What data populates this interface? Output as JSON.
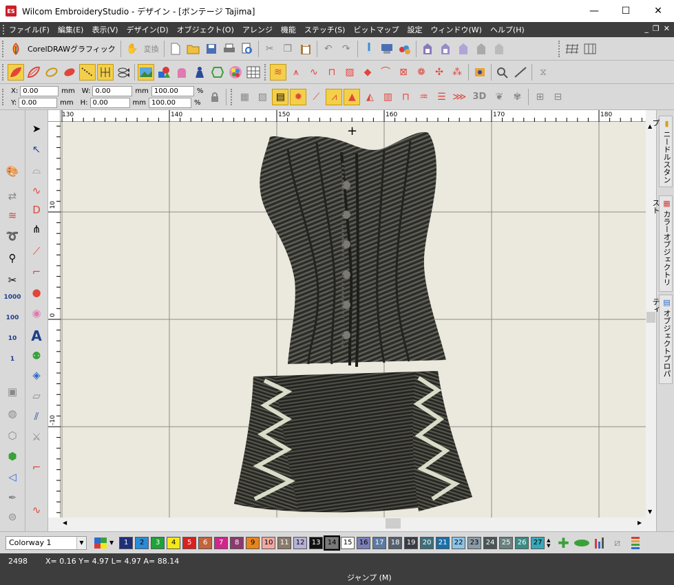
{
  "window": {
    "title": "Wilcom EmbroideryStudio - デザイン - [ボンテージ          Tajima]",
    "logo_text": "ES",
    "minimize": "—",
    "maximize": "☐",
    "close": "✕"
  },
  "menu": [
    "ファイル(F)",
    "編集(E)",
    "表示(V)",
    "デザイン(D)",
    "オブジェクト(O)",
    "アレンジ",
    "機能",
    "ステッチ(S)",
    "ビットマップ",
    "設定",
    "ウィンドウ(W)",
    "ヘルプ(H)"
  ],
  "mdi_controls": [
    "_",
    "❐",
    "✕"
  ],
  "toolbar1": {
    "coreldraw_label": "CorelDRAWグラフィック",
    "convert_label": "変換"
  },
  "coords": {
    "x_label": "X:",
    "x_value": "0.00",
    "y_label": "Y:",
    "y_value": "0.00",
    "w_label": "W:",
    "w_value": "0.00",
    "h_label": "H:",
    "h_value": "0.00",
    "scale_x": "100.00",
    "scale_y": "100.00",
    "unit_mm": "mm",
    "unit_pct": "%"
  },
  "toolbar3_text": {
    "three_d": "3D"
  },
  "ruler": {
    "top_labels": [
      "130",
      "140",
      "150",
      "160",
      "170",
      "180"
    ],
    "left_labels": [
      "10",
      "0",
      "-10"
    ]
  },
  "left_tools": {
    "n1000": "1000",
    "n100": "100",
    "n10": "10",
    "n1": "1"
  },
  "dock_tabs": [
    "ニードルスタンプ",
    "カラーオブジェクトリスト",
    "オブジェクトプロパティ"
  ],
  "colorway": "Colorway 1",
  "palette": [
    {
      "n": "1",
      "color": "#1f2f7a",
      "fg": "#fff"
    },
    {
      "n": "2",
      "color": "#2a8bd6",
      "fg": "#000"
    },
    {
      "n": "3",
      "color": "#1fa23a",
      "fg": "#fff"
    },
    {
      "n": "4",
      "color": "#f5e818",
      "fg": "#000"
    },
    {
      "n": "5",
      "color": "#d9221f",
      "fg": "#fff"
    },
    {
      "n": "6",
      "color": "#c4643c",
      "fg": "#fff"
    },
    {
      "n": "7",
      "color": "#d0278a",
      "fg": "#fff"
    },
    {
      "n": "8",
      "color": "#8c3a6e",
      "fg": "#fff"
    },
    {
      "n": "9",
      "color": "#e9841d",
      "fg": "#000"
    },
    {
      "n": "10",
      "color": "#f2a8a0",
      "fg": "#000"
    },
    {
      "n": "11",
      "color": "#8a7b6c",
      "fg": "#fff"
    },
    {
      "n": "12",
      "color": "#b9b0d8",
      "fg": "#000"
    },
    {
      "n": "13",
      "color": "#111111",
      "fg": "#fff"
    },
    {
      "n": "14",
      "color": "#7a7a7a",
      "fg": "#000"
    },
    {
      "n": "15",
      "color": "#ffffff",
      "fg": "#000"
    },
    {
      "n": "16",
      "color": "#7a7fb8",
      "fg": "#000"
    },
    {
      "n": "17",
      "color": "#5d7aa3",
      "fg": "#fff"
    },
    {
      "n": "18",
      "color": "#55606e",
      "fg": "#fff"
    },
    {
      "n": "19",
      "color": "#3b3b44",
      "fg": "#fff"
    },
    {
      "n": "20",
      "color": "#3b6e7c",
      "fg": "#fff"
    },
    {
      "n": "21",
      "color": "#1b6fa8",
      "fg": "#fff"
    },
    {
      "n": "22",
      "color": "#8cc3e6",
      "fg": "#000"
    },
    {
      "n": "23",
      "color": "#8a9aa6",
      "fg": "#000"
    },
    {
      "n": "24",
      "color": "#4a5656",
      "fg": "#fff"
    },
    {
      "n": "25",
      "color": "#6a8080",
      "fg": "#fff"
    },
    {
      "n": "26",
      "color": "#3a8c84",
      "fg": "#fff"
    },
    {
      "n": "27",
      "color": "#38a8b8",
      "fg": "#000"
    }
  ],
  "status": {
    "stitch_count": "2498",
    "readout": "X=  0.16 Y=   4.97 L=   4.97 A=  88.14",
    "jump_label": "ジャンプ (M)"
  }
}
